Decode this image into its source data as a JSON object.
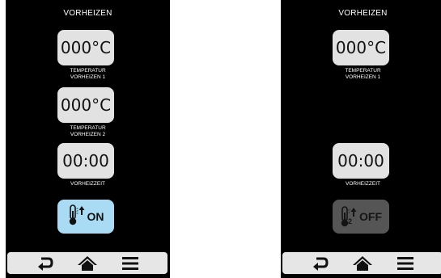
{
  "left_screen": {
    "title": "VORHEIZEN",
    "temp1": {
      "value": "000°C",
      "caption_line1": "TEMPERATUR",
      "caption_line2": "VORHEIZEN 1"
    },
    "temp2": {
      "value": "000°C",
      "caption_line1": "TEMPERATUR",
      "caption_line2": "VORHEIZEN 2"
    },
    "time": {
      "value": "00:00",
      "caption": "VORHEIZZEIT"
    },
    "toggle": {
      "label": "ON",
      "icon": "thermometer-up-icon",
      "color": "#a9dcf4"
    }
  },
  "right_screen": {
    "title": "VORHEIZEN",
    "temp1": {
      "value": "000°C",
      "caption_line1": "TEMPERATUR",
      "caption_line2": "VORHEIZEN 1"
    },
    "time": {
      "value": "00:00",
      "caption": "VORHEIZZEIT"
    },
    "toggle": {
      "label": "OFF",
      "icon": "thermometer-2-up-icon",
      "sub_label": "2",
      "color": "#555555"
    }
  },
  "navbar": {
    "icons": [
      "back-icon",
      "home-icon",
      "menu-icon"
    ]
  }
}
